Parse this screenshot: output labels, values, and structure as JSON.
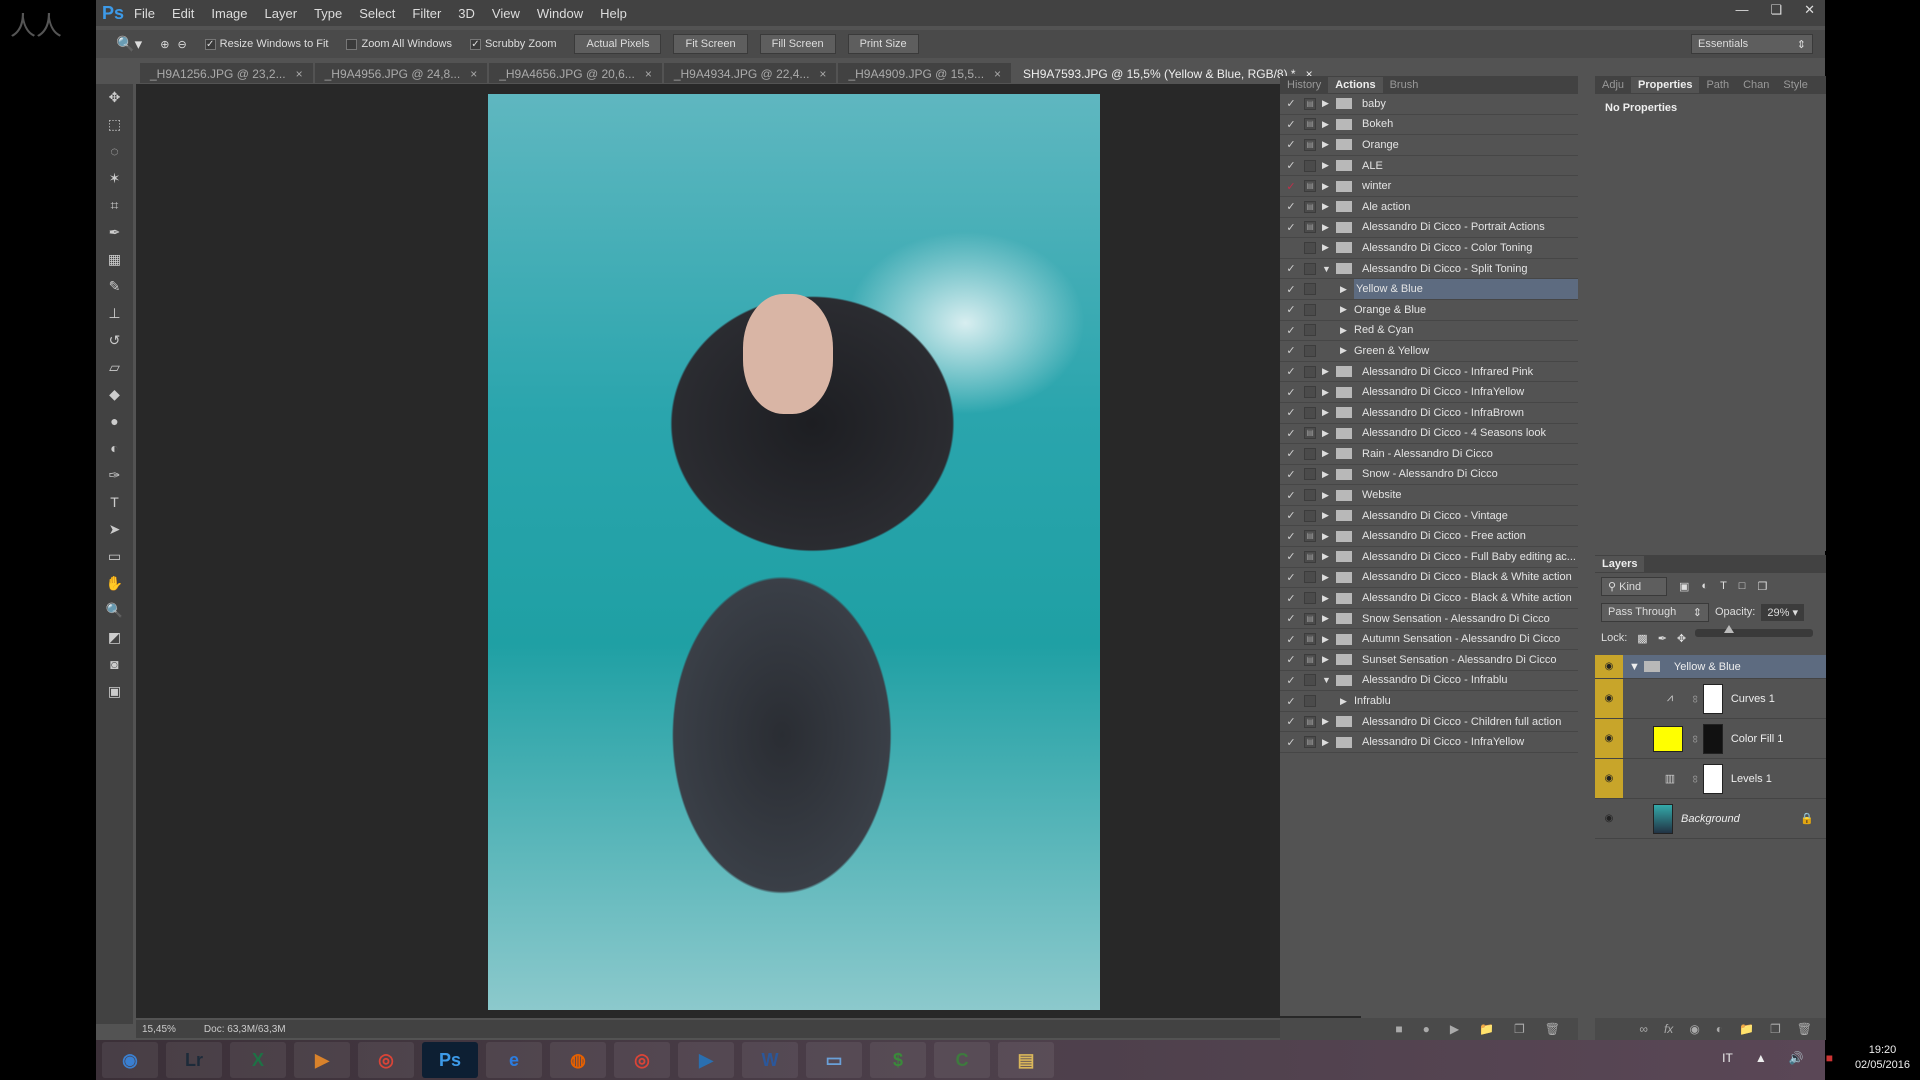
{
  "watermark": "人人素材",
  "app": {
    "logo": "Ps",
    "menu": [
      "File",
      "Edit",
      "Image",
      "Layer",
      "Type",
      "Select",
      "Filter",
      "3D",
      "View",
      "Window",
      "Help"
    ],
    "window_buttons": [
      "minimize-icon",
      "restore-icon",
      "close-icon"
    ]
  },
  "options": {
    "resize_windows": "Resize Windows to Fit",
    "resize_checked": true,
    "zoom_all": "Zoom All Windows",
    "zoom_all_checked": false,
    "scrubby": "Scrubby Zoom",
    "scrubby_checked": true,
    "buttons": [
      "Actual Pixels",
      "Fit Screen",
      "Fill Screen",
      "Print Size"
    ],
    "workspace": "Essentials"
  },
  "tabs": [
    {
      "label": "_H9A1256.JPG @ 23,2..."
    },
    {
      "label": "_H9A4956.JPG @ 24,8..."
    },
    {
      "label": "_H9A4656.JPG @ 20,6..."
    },
    {
      "label": "_H9A4934.JPG @ 22,4..."
    },
    {
      "label": "_H9A4909.JPG @ 15,5..."
    },
    {
      "label": "SH9A7593.JPG @ 15,5% (Yellow & Blue, RGB/8) *",
      "active": true
    }
  ],
  "status": {
    "zoom": "15,45%",
    "doc": "Doc: 63,3M/63,3M"
  },
  "actions_panel": {
    "tabs": [
      "History",
      "Actions",
      "Brush"
    ],
    "active": "Actions",
    "items": [
      {
        "label": "baby",
        "check": true,
        "dialog": true,
        "level": 0
      },
      {
        "label": "Bokeh",
        "check": true,
        "dialog": true,
        "level": 0
      },
      {
        "label": "Orange",
        "check": true,
        "dialog": true,
        "level": 0
      },
      {
        "label": "ALE",
        "check": true,
        "dialog": false,
        "level": 0
      },
      {
        "label": "winter",
        "check": true,
        "red": true,
        "dialog": true,
        "level": 0
      },
      {
        "label": "Ale action",
        "check": true,
        "dialog": true,
        "level": 0
      },
      {
        "label": "Alessandro Di Cicco - Portrait Actions",
        "check": true,
        "dialog": true,
        "level": 0
      },
      {
        "label": "Alessandro Di Cicco - Color Toning",
        "check": false,
        "dialog": false,
        "level": 0
      },
      {
        "label": "Alessandro Di Cicco - Split Toning",
        "check": true,
        "dialog": false,
        "level": 0,
        "open": true
      },
      {
        "label": "Yellow & Blue",
        "check": true,
        "dialog": false,
        "level": 1,
        "selected": true
      },
      {
        "label": "Orange & Blue",
        "check": true,
        "dialog": false,
        "level": 1
      },
      {
        "label": "Red & Cyan",
        "check": true,
        "dialog": false,
        "level": 1
      },
      {
        "label": "Green & Yellow",
        "check": true,
        "dialog": false,
        "level": 1
      },
      {
        "label": "Alessandro Di Cicco - Infrared Pink",
        "check": true,
        "dialog": false,
        "level": 0
      },
      {
        "label": "Alessandro Di Cicco - InfraYellow",
        "check": true,
        "dialog": false,
        "level": 0
      },
      {
        "label": "Alessandro Di Cicco - InfraBrown",
        "check": true,
        "dialog": false,
        "level": 0
      },
      {
        "label": "Alessandro Di Cicco - 4 Seasons look",
        "check": true,
        "dialog": true,
        "level": 0
      },
      {
        "label": "Rain - Alessandro Di Cicco",
        "check": true,
        "dialog": false,
        "level": 0
      },
      {
        "label": "Snow - Alessandro Di Cicco",
        "check": true,
        "dialog": false,
        "level": 0
      },
      {
        "label": "Website",
        "check": true,
        "dialog": false,
        "level": 0
      },
      {
        "label": "Alessandro Di Cicco - Vintage",
        "check": true,
        "dialog": false,
        "level": 0
      },
      {
        "label": "Alessandro Di Cicco - Free action",
        "check": true,
        "dialog": true,
        "level": 0
      },
      {
        "label": "Alessandro Di Cicco - Full Baby editing ac...",
        "check": true,
        "dialog": true,
        "level": 0
      },
      {
        "label": "Alessandro Di Cicco - Black & White action",
        "check": true,
        "dialog": false,
        "level": 0
      },
      {
        "label": "Alessandro Di Cicco - Black & White action",
        "check": true,
        "dialog": false,
        "level": 0
      },
      {
        "label": "Snow Sensation - Alessandro Di Cicco",
        "check": true,
        "dialog": true,
        "level": 0
      },
      {
        "label": "Autumn Sensation - Alessandro Di Cicco",
        "check": true,
        "dialog": true,
        "level": 0
      },
      {
        "label": "Sunset Sensation - Alessandro Di Cicco",
        "check": true,
        "dialog": true,
        "level": 0
      },
      {
        "label": "Alessandro Di Cicco - Infrablu",
        "check": true,
        "dialog": false,
        "level": 0,
        "open": true
      },
      {
        "label": "Infrablu",
        "check": true,
        "dialog": false,
        "level": 1
      },
      {
        "label": "Alessandro Di Cicco - Children full action",
        "check": true,
        "dialog": true,
        "level": 0
      },
      {
        "label": "Alessandro Di Cicco - InfraYellow",
        "check": true,
        "dialog": true,
        "level": 0
      }
    ],
    "footer_icons": [
      "stop-icon",
      "record-icon",
      "play-icon",
      "new-set-icon",
      "new-action-icon",
      "delete-icon"
    ]
  },
  "properties_panel": {
    "tabs": [
      "Adju",
      "Properties",
      "Path",
      "Chan",
      "Style"
    ],
    "active": "Properties",
    "message": "No Properties"
  },
  "layers_panel": {
    "title": "Layers",
    "filter": "Kind",
    "blend_mode": "Pass Through",
    "opacity_label": "Opacity:",
    "opacity": "29%",
    "opacity_value": 29,
    "lock_label": "Lock:",
    "layers": [
      {
        "name": "Yellow & Blue",
        "type": "group",
        "visible": true,
        "selected": true
      },
      {
        "name": "Curves 1",
        "type": "curves",
        "visible": true,
        "mask": "#ffffff"
      },
      {
        "name": "Color Fill 1",
        "type": "fill",
        "visible": true,
        "fill": "#ffff00",
        "mask": "#111111"
      },
      {
        "name": "Levels 1",
        "type": "levels",
        "visible": true,
        "mask": "#ffffff"
      },
      {
        "name": "Background",
        "type": "image",
        "visible": true,
        "locked": true
      }
    ],
    "footer_icons": [
      "link-icon",
      "fx-icon",
      "mask-icon",
      "adjustment-icon",
      "group-icon",
      "new-layer-icon",
      "delete-icon"
    ]
  },
  "taskbar": {
    "apps": [
      "start",
      "Lr",
      "excel",
      "media",
      "chrome",
      "Ps",
      "ie",
      "firefox",
      "chrome",
      "player",
      "Word",
      "explorer",
      "money",
      "camtasia",
      "folder"
    ],
    "lang": "IT",
    "time": "19:20",
    "date": "02/05/2016"
  }
}
